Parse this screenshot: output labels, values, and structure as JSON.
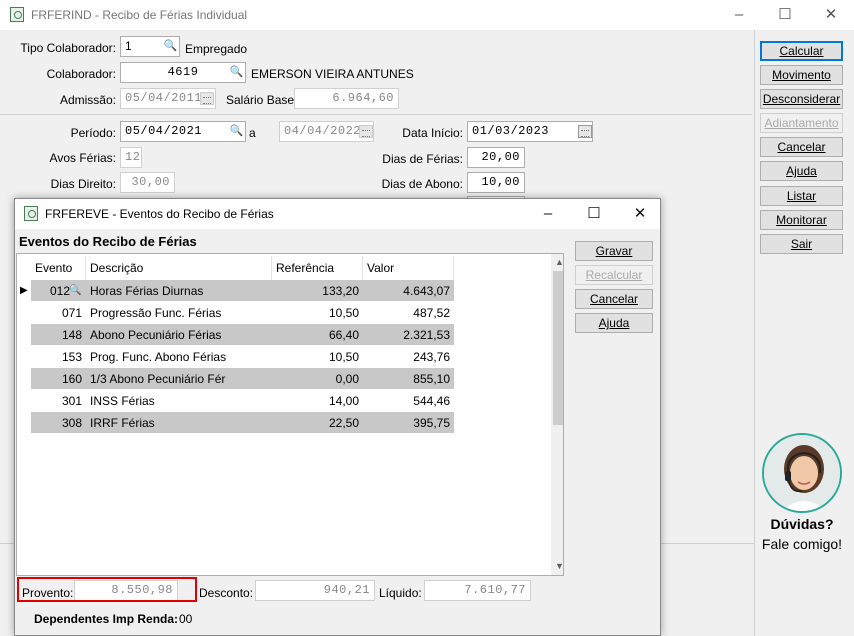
{
  "main": {
    "title": "FRFERIND - Recibo de Férias Individual",
    "fields": {
      "tipo_colaborador_label": "Tipo Colaborador:",
      "tipo_colaborador_value": "1",
      "tipo_colaborador_desc": "Empregado",
      "colaborador_label": "Colaborador:",
      "colaborador_value": "4619",
      "colaborador_name": "EMERSON VIEIRA ANTUNES",
      "admissao_label": "Admissão:",
      "admissao_value": "05/04/2011",
      "salario_label": "Salário Base:",
      "salario_value": "6.964,60",
      "periodo_label": "Período:",
      "periodo_inicio": "05/04/2021",
      "periodo_a": "a",
      "periodo_fim": "04/04/2022",
      "data_inicio_label": "Data Início:",
      "data_inicio_value": "01/03/2023",
      "avos_label": "Avos Férias:",
      "avos_value": "12",
      "dias_ferias_label": "Dias de Férias:",
      "dias_ferias_value": "20,00",
      "dias_direito_label": "Dias Direito:",
      "dias_direito_value": "30,00",
      "dias_abono_label": "Dias de Abono:",
      "dias_abono_value": "10,00"
    },
    "buttons": [
      "Calcular",
      "Movimento",
      "Desconsiderar",
      "Adiantamento",
      "Cancelar",
      "Ajuda",
      "Listar",
      "Monitorar",
      "Sair"
    ],
    "help": {
      "line1": "Dúvidas?",
      "line2": "Fale comigo!"
    }
  },
  "dialog": {
    "title": "FRFEREVE - Eventos do Recibo de Férias",
    "heading": "Eventos do Recibo de Férias",
    "columns": [
      "Evento",
      "Descrição",
      "Referência",
      "Valor"
    ],
    "rows": [
      {
        "evento": "012",
        "descricao": "Horas Férias Diurnas",
        "referencia": "133,20",
        "valor": "4.643,07"
      },
      {
        "evento": "071",
        "descricao": "Progressão Func. Férias",
        "referencia": "10,50",
        "valor": "487,52"
      },
      {
        "evento": "148",
        "descricao": "Abono Pecuniário Férias",
        "referencia": "66,40",
        "valor": "2.321,53"
      },
      {
        "evento": "153",
        "descricao": "Prog. Func. Abono Férias",
        "referencia": "10,50",
        "valor": "243,76"
      },
      {
        "evento": "160",
        "descricao": "1/3 Abono Pecuniário Fér",
        "referencia": "0,00",
        "valor": "855,10"
      },
      {
        "evento": "301",
        "descricao": "INSS Férias",
        "referencia": "14,00",
        "valor": "544,46"
      },
      {
        "evento": "308",
        "descricao": "IRRF Férias",
        "referencia": "22,50",
        "valor": "395,75"
      }
    ],
    "buttons": [
      "Gravar",
      "Recalcular",
      "Cancelar",
      "Ajuda"
    ],
    "totals": {
      "provento_label": "Provento:",
      "provento_value": "8.550,98",
      "desconto_label": "Desconto:",
      "desconto_value": "940,21",
      "liquido_label": "Líquido:",
      "liquido_value": "7.610,77"
    },
    "dependentes_label": "Dependentes Imp Renda:",
    "dependentes_value": "00"
  }
}
